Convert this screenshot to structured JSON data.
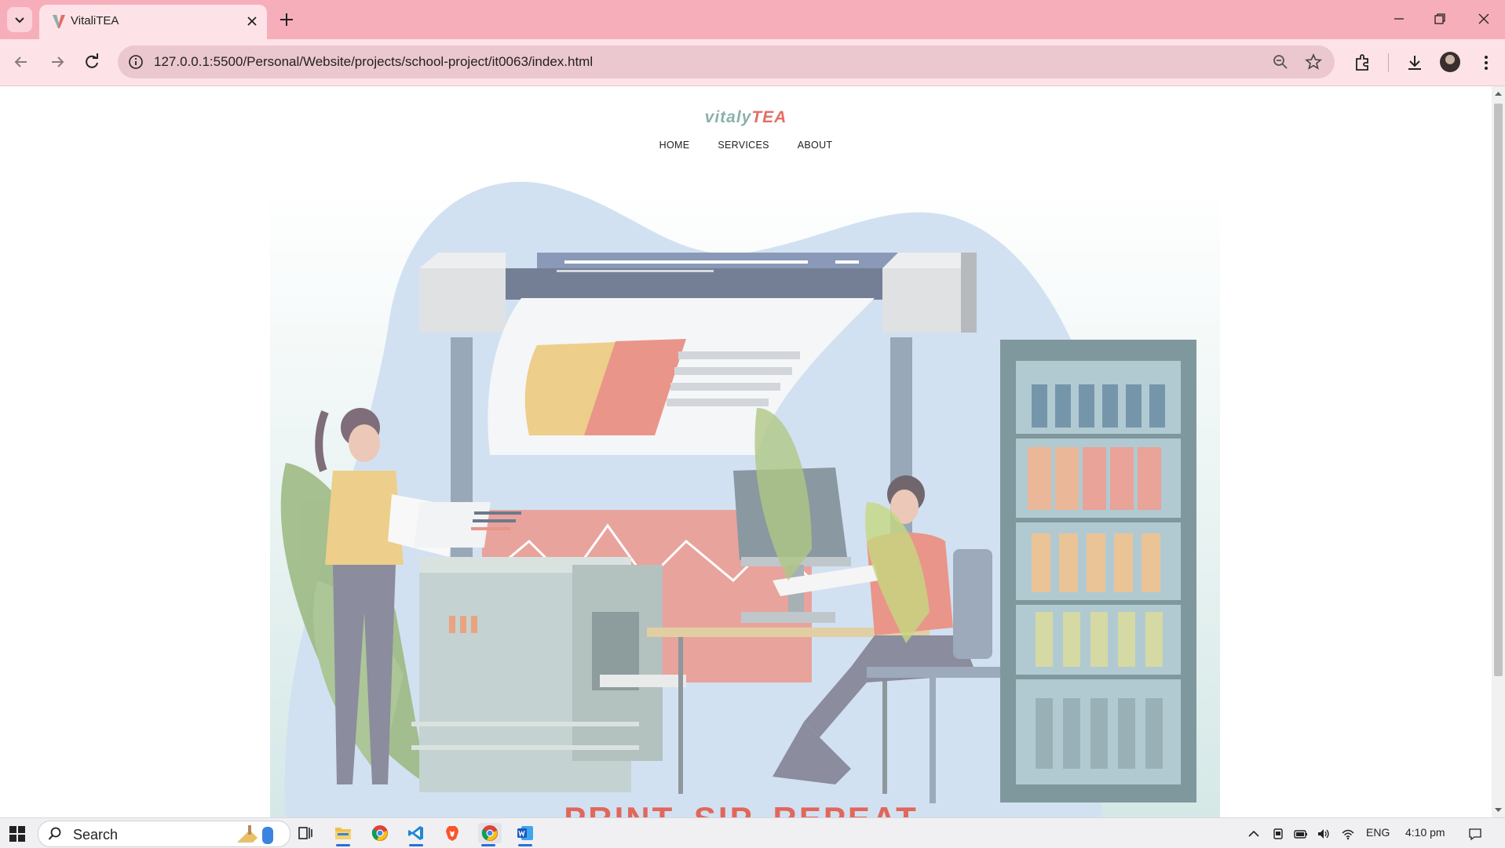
{
  "browser": {
    "tab_title": "VitaliTEA",
    "url": "127.0.0.1:5500/Personal/Website/projects/school-project/it0063/index.html",
    "icons": [
      "tab-list-icon",
      "favicon-v",
      "close-tab-icon",
      "new-tab-icon",
      "minimize-icon",
      "restore-icon",
      "close-window-icon",
      "back-icon",
      "forward-icon",
      "reload-icon",
      "site-info-icon",
      "zoom-icon",
      "bookmark-star-icon",
      "extensions-icon",
      "download-icon",
      "profile-avatar",
      "menu-kebab-icon"
    ]
  },
  "site": {
    "logo_part1": "vitaly",
    "logo_part2": "TEA",
    "nav": [
      "HOME",
      "SERVICES",
      "ABOUT"
    ],
    "headline": "PRINT. SIP. REPEAT.",
    "hero_alt": "illustration of a print shop with two people"
  },
  "colors": {
    "tabbar": "#f7aebb",
    "toolbar": "#fde3e8",
    "logo_teal": "#8bb1ac",
    "logo_red": "#e26e64",
    "headline_red": "#e35a4a"
  },
  "taskbar": {
    "search_placeholder": "Search",
    "language": "ENG",
    "time": "4:10 pm"
  }
}
